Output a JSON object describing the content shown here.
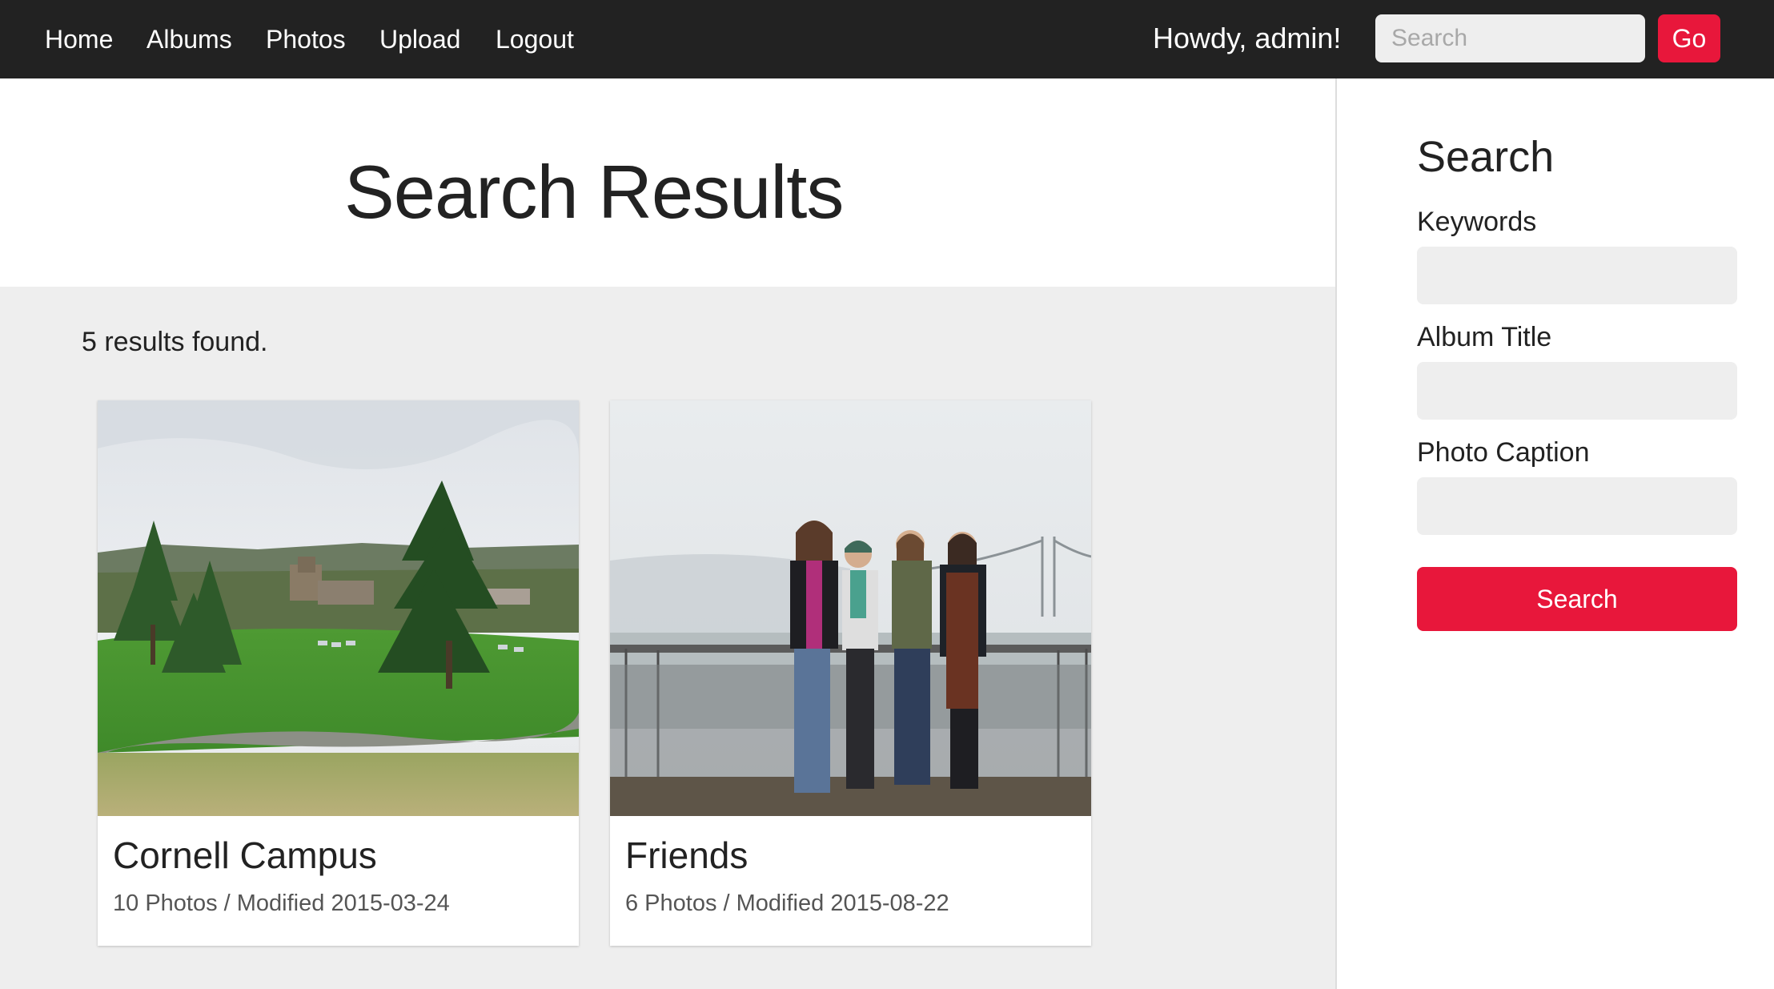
{
  "nav": {
    "links": [
      "Home",
      "Albums",
      "Photos",
      "Upload",
      "Logout"
    ],
    "greeting": "Howdy, admin!",
    "search_placeholder": "Search",
    "go_label": "Go"
  },
  "main": {
    "title": "Search Results",
    "results_count": "5 results found.",
    "cards": [
      {
        "title": "Cornell Campus",
        "meta": "10 Photos / Modified 2015-03-24",
        "photo": "campus-landscape-photo"
      },
      {
        "title": "Friends",
        "meta": "6 Photos / Modified 2015-08-22",
        "photo": "friends-group-photo"
      }
    ]
  },
  "sidebar": {
    "heading": "Search",
    "keywords_label": "Keywords",
    "album_title_label": "Album Title",
    "photo_caption_label": "Photo Caption",
    "search_button": "Search"
  },
  "colors": {
    "nav_bg": "#222222",
    "accent": "#e8173b",
    "panel_bg": "#eeeeee"
  }
}
